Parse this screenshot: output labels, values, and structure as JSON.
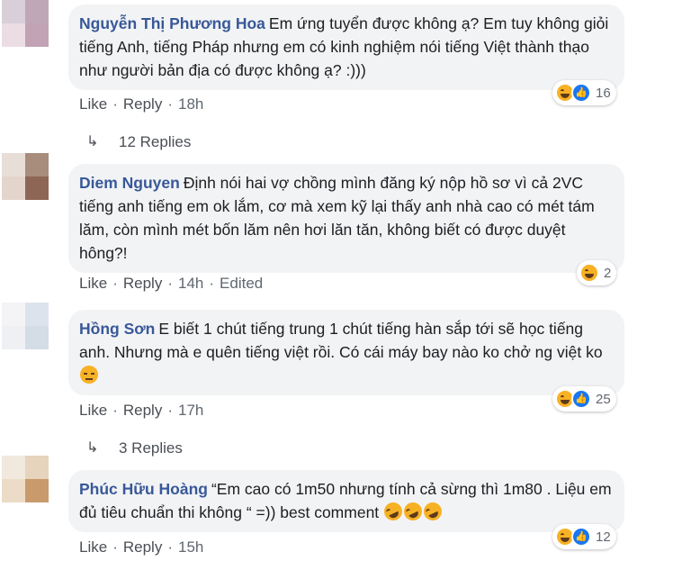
{
  "comments": [
    {
      "author": "Nguyễn Thị Phương Hoa",
      "text": "Em ứng tuyển được không ạ? Em tuy không giỏi tiếng Anh, tiếng Pháp nhưng em có kinh nghiệm nói tiếng Việt thành thạo như người bản địa có được không ạ? :)))",
      "like": "Like",
      "reply": "Reply",
      "time": "18h",
      "reaction_count": "16",
      "reaction_icons": [
        "haha-icon",
        "like-icon"
      ],
      "replies": "12 Replies"
    },
    {
      "author": "Diem Nguyen",
      "text": "Định nói hai vợ chồng mình đăng ký nộp hồ sơ vì cả 2VC tiếng anh tiếng em ok lắm, cơ mà xem kỹ lại thấy anh nhà cao có mét tám lăm, còn mình mét bốn lăm nên hơi lăn tăn, không biết có được duyệt hông?!",
      "like": "Like",
      "reply": "Reply",
      "time": "14h",
      "edited": "Edited",
      "reaction_count": "2",
      "reaction_icons": [
        "haha-icon"
      ]
    },
    {
      "author": "Hồng Sơn",
      "text": "E biết 1 chút tiếng trung 1 chút tiếng hàn sắp tới sẽ học tiếng anh. Nhưng mà e quên tiếng việt rồi. Có cái máy bay nào ko chở ng việt ko",
      "emoji": "disappointed-face-emoji",
      "like": "Like",
      "reply": "Reply",
      "time": "17h",
      "reaction_count": "25",
      "reaction_icons": [
        "haha-icon",
        "like-icon"
      ],
      "replies": "3 Replies"
    },
    {
      "author": "Phúc Hữu Hoàng",
      "text": "“Em cao có 1m50 nhưng tính cả sừng thì 1m80 . Liệu em đủ tiêu chuẩn thi không “ =)) best comment",
      "emoji": "rolling-on-floor-laughing-emoji",
      "like": "Like",
      "reply": "Reply",
      "time": "15h",
      "reaction_count": "12",
      "reaction_icons": [
        "haha-icon",
        "like-icon"
      ]
    }
  ],
  "colors": {
    "author": "#385898",
    "bubble": "#f2f3f5",
    "meta": "#606770",
    "like_blue": "#1877f2",
    "haha_yellow": "#f7b125"
  }
}
